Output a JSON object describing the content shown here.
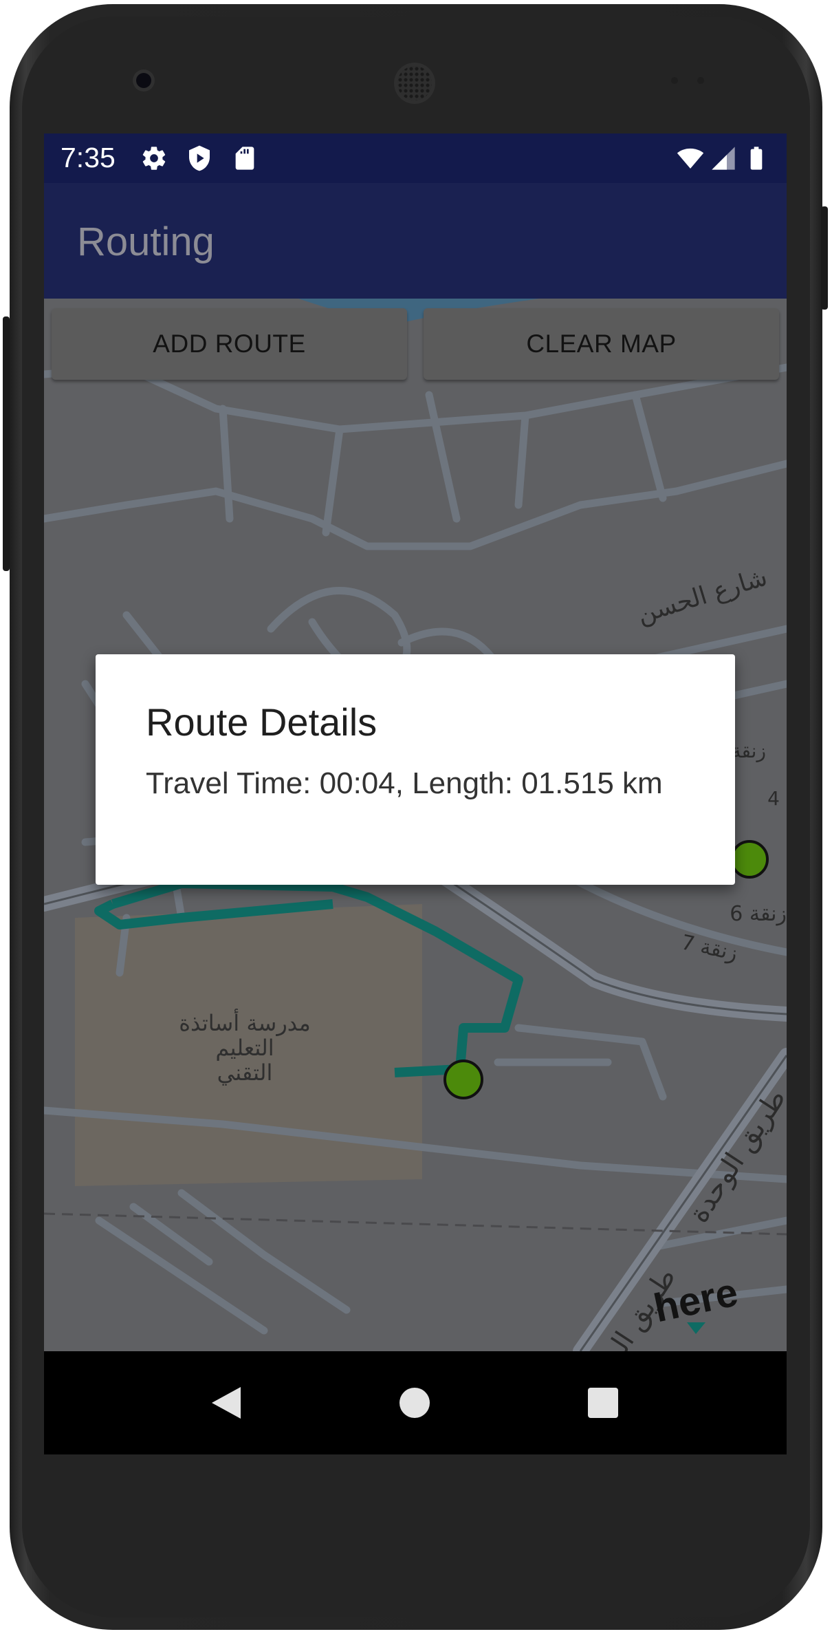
{
  "status_bar": {
    "time": "7:35",
    "icons": [
      "settings-gear-icon",
      "play-protect-shield-icon",
      "sd-card-icon",
      "wifi-icon",
      "cell-signal-icon",
      "battery-icon"
    ]
  },
  "app_bar": {
    "title": "Routing"
  },
  "toolbar": {
    "add_route_label": "ADD ROUTE",
    "clear_map_label": "CLEAR MAP"
  },
  "map": {
    "street_labels": [
      "شارع الحسن",
      "طريق الوحدة",
      "طريق الوحدة",
      "زنقة 7",
      "زنقة 6",
      "4",
      "زنقة"
    ],
    "poi_label_lines": [
      "مدرسة أساتذة",
      "التعليم",
      "التقني"
    ],
    "logo": "here",
    "route_color": "#0e6b63",
    "marker_color": "#4c8a0b"
  },
  "dialog": {
    "title": "Route Details",
    "message": "Travel Time: 00:04, Length: 01.515 km"
  },
  "nav_bar": {
    "icons": [
      "back-icon",
      "home-icon",
      "recents-icon"
    ]
  }
}
